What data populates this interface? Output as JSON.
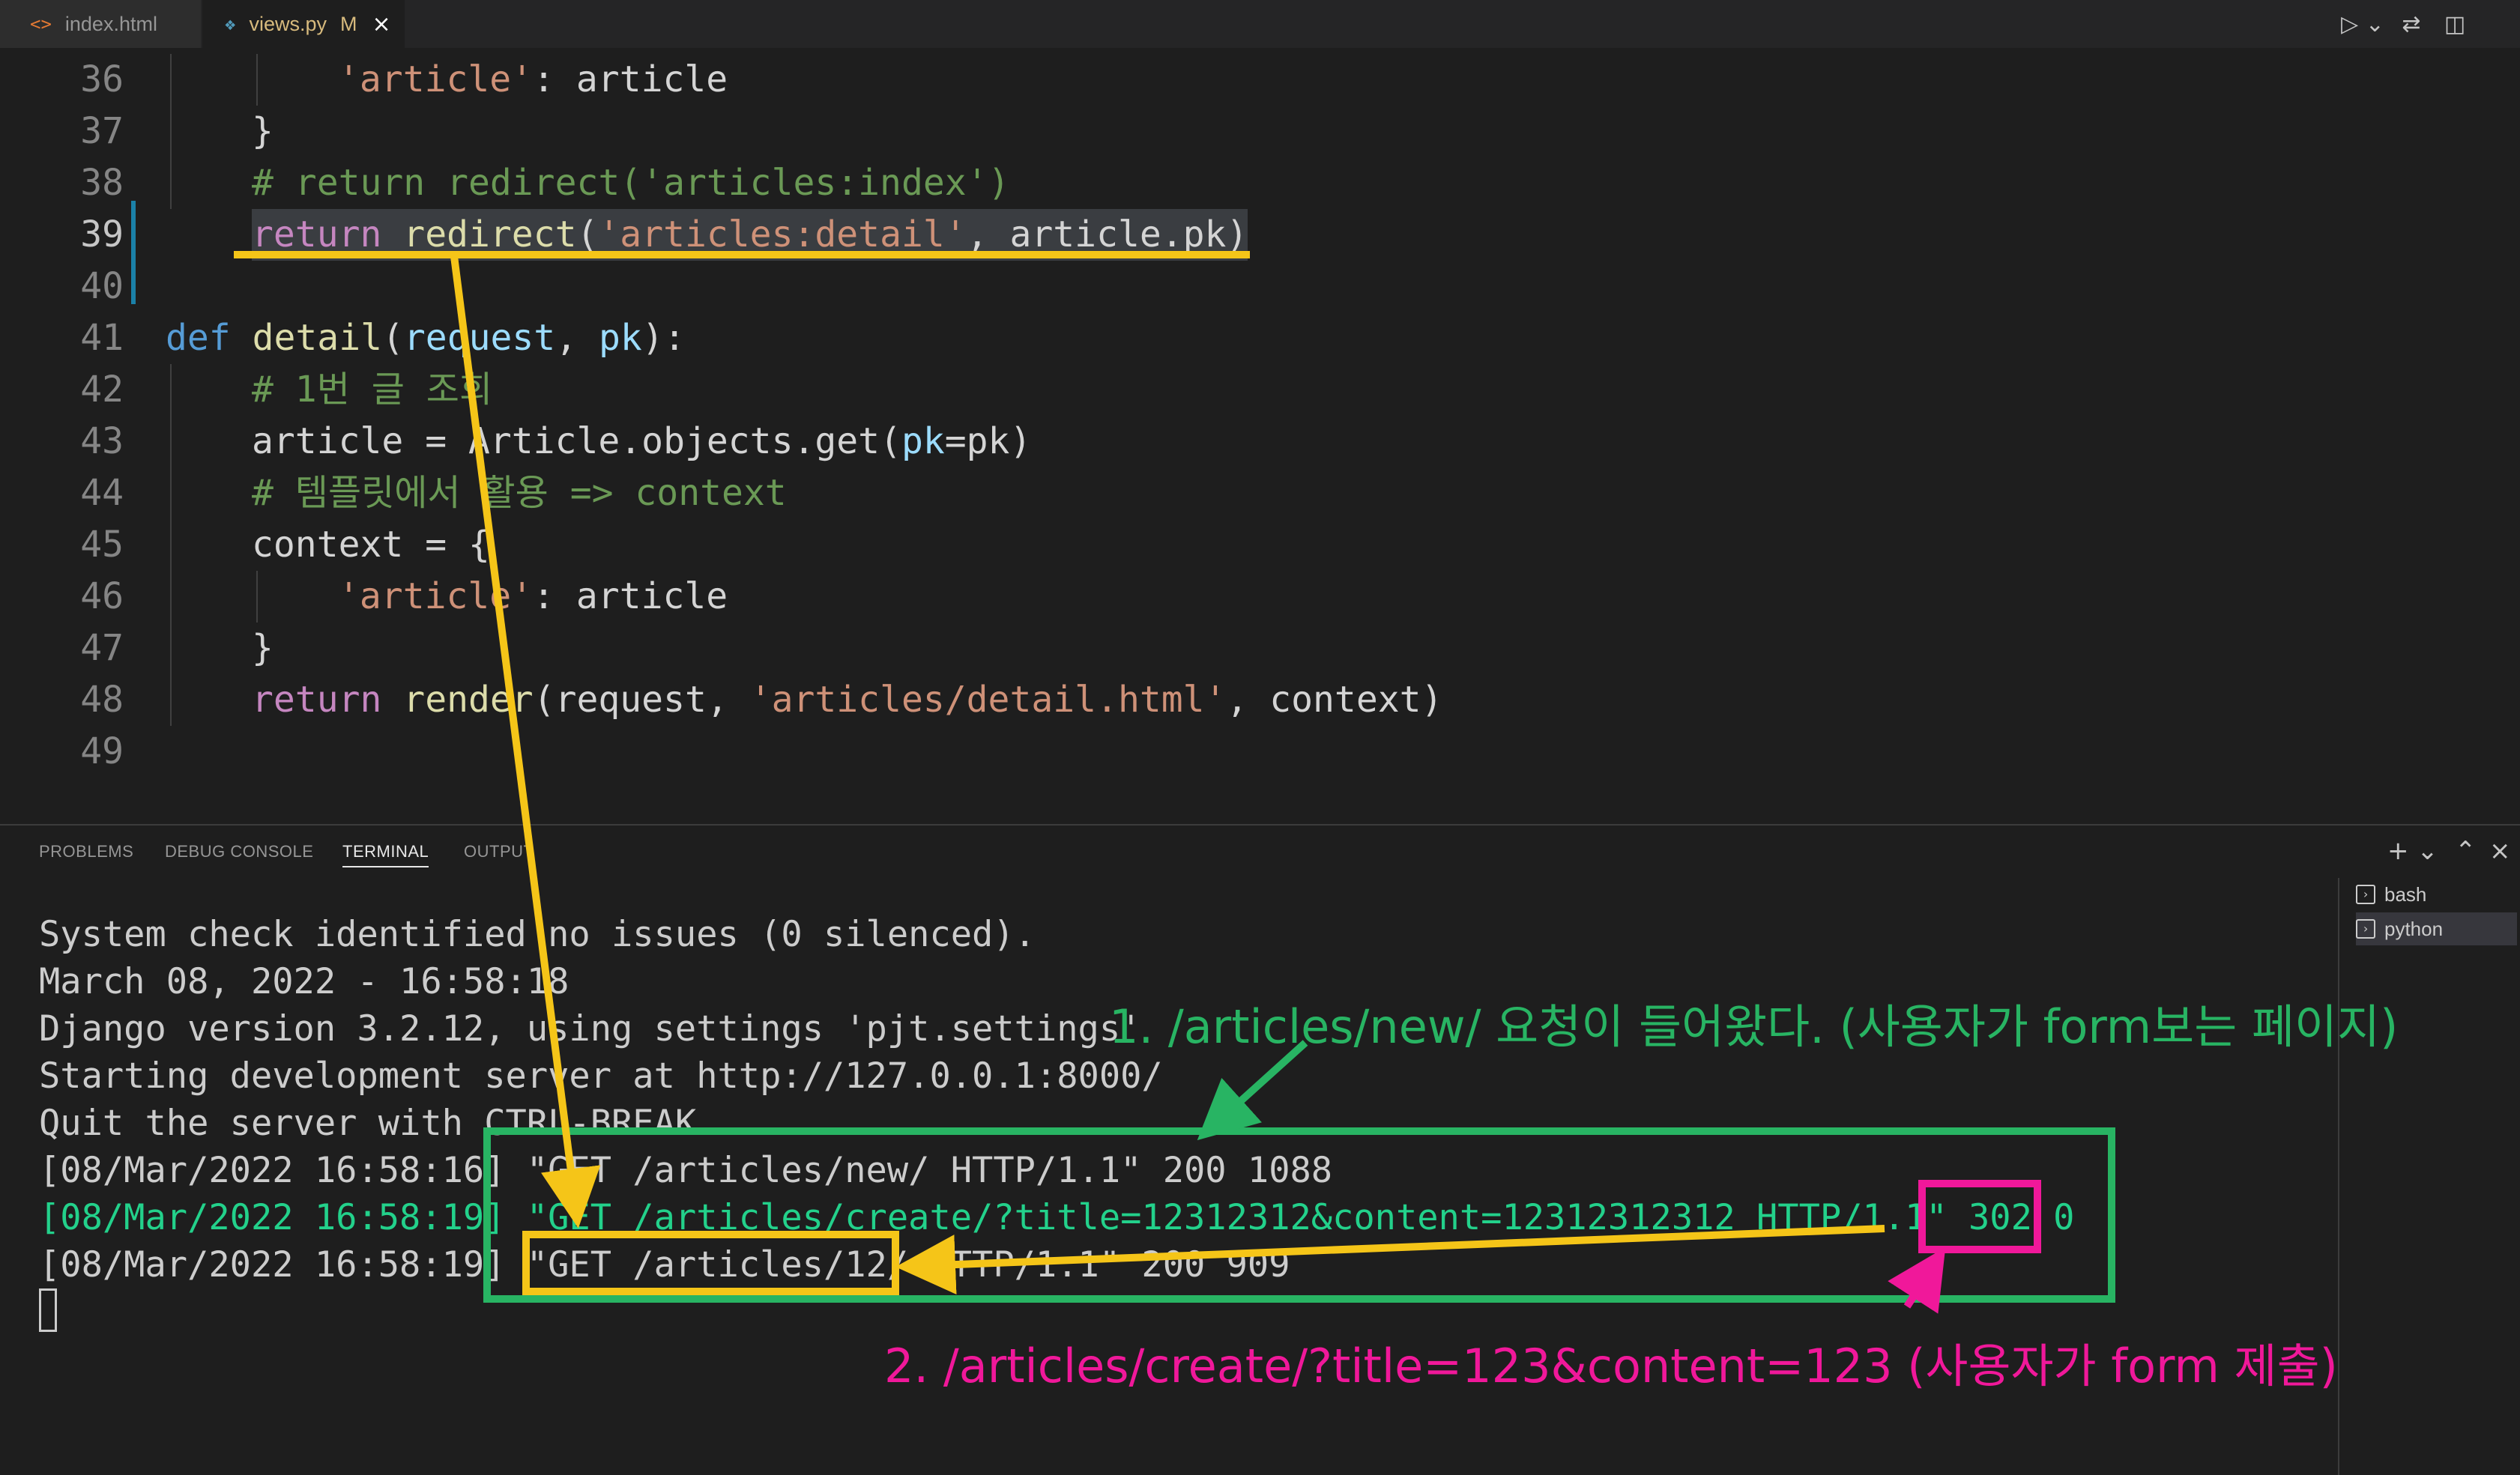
{
  "tabs": [
    {
      "icon": "<>",
      "label": "index.html"
    },
    {
      "icon": "py",
      "label": "views.py",
      "modified": "M",
      "close": "×"
    }
  ],
  "toolbar": {
    "run": "▷ ⌄",
    "compare": "⇄",
    "split": "◫"
  },
  "editor": {
    "lines": [
      {
        "n": "36",
        "indent": 2,
        "tokens": [
          [
            "str",
            "'article'"
          ],
          [
            "txt",
            ": article"
          ]
        ]
      },
      {
        "n": "37",
        "indent": 1,
        "tokens": [
          [
            "txt",
            "}"
          ]
        ]
      },
      {
        "n": "38",
        "indent": 1,
        "tokens": [
          [
            "cmt",
            "# return redirect('articles:index')"
          ]
        ]
      },
      {
        "n": "39",
        "indent": 1,
        "active": true,
        "tokens": [
          [
            "kw",
            "return"
          ],
          [
            "txt",
            " "
          ],
          [
            "fn",
            "redirect"
          ],
          [
            "txt",
            "("
          ],
          [
            "str",
            "'articles:detail'"
          ],
          [
            "txt",
            ", article.pk)"
          ]
        ]
      },
      {
        "n": "40",
        "indent": 0,
        "tokens": []
      },
      {
        "n": "41",
        "indent": 0,
        "tokens": [
          [
            "kw-def",
            "def"
          ],
          [
            "txt",
            " "
          ],
          [
            "fn",
            "detail"
          ],
          [
            "txt",
            "("
          ],
          [
            "var",
            "request"
          ],
          [
            "txt",
            ", "
          ],
          [
            "var",
            "pk"
          ],
          [
            "txt",
            "):"
          ]
        ]
      },
      {
        "n": "42",
        "indent": 1,
        "tokens": [
          [
            "cmt",
            "# 1번 글 조회"
          ]
        ]
      },
      {
        "n": "43",
        "indent": 1,
        "tokens": [
          [
            "txt",
            "article = Article.objects.get("
          ],
          [
            "var",
            "pk"
          ],
          [
            "txt",
            "=pk)"
          ]
        ]
      },
      {
        "n": "44",
        "indent": 1,
        "tokens": [
          [
            "cmt",
            "# 템플릿에서 활용 => context"
          ]
        ]
      },
      {
        "n": "45",
        "indent": 1,
        "tokens": [
          [
            "txt",
            "context = {"
          ]
        ]
      },
      {
        "n": "46",
        "indent": 2,
        "tokens": [
          [
            "str",
            "'article'"
          ],
          [
            "txt",
            ": article"
          ]
        ]
      },
      {
        "n": "47",
        "indent": 1,
        "tokens": [
          [
            "txt",
            "}"
          ]
        ]
      },
      {
        "n": "48",
        "indent": 1,
        "tokens": [
          [
            "kw",
            "return"
          ],
          [
            "txt",
            " "
          ],
          [
            "fn",
            "render"
          ],
          [
            "txt",
            "(request, "
          ],
          [
            "str",
            "'articles/detail.html'"
          ],
          [
            "txt",
            ", context)"
          ]
        ]
      },
      {
        "n": "49",
        "indent": 0,
        "tokens": []
      }
    ]
  },
  "panel": {
    "tabs": [
      "PROBLEMS",
      "DEBUG CONSOLE",
      "TERMINAL",
      "OUTPUT"
    ],
    "active_tab": "TERMINAL",
    "actions": {
      "add": "+ ⌄",
      "maximize": "⌃",
      "close": "×"
    },
    "terminals": [
      "bash",
      "python"
    ]
  },
  "terminal": {
    "lines": [
      "System check identified no issues (0 silenced).",
      "March 08, 2022 - 16:58:18",
      "Django version 3.2.12, using settings 'pjt.settings'",
      "Starting development server at http://127.0.0.1:8000/",
      "Quit the server with CTRL-BREAK.",
      "[08/Mar/2022 16:58:16] \"GET /articles/new/ HTTP/1.1\" 200 1088",
      "[08/Mar/2022 16:58:19] \"GET /articles/create/?title=12312312&content=12312312312 HTTP/1.1\" 302 0",
      "[08/Mar/2022 16:58:19] \"GET /articles/12/ HTTP/1.1\" 200 909"
    ]
  },
  "annotations": {
    "step1": "1. /articles/new/ 요청이 들어왔다. (사용자가 form보는 페이지)",
    "step2": "2. /articles/create/?title=123&content=123 (사용자가 form 제출)"
  },
  "colors": {
    "annotation_yellow": "#f5c518",
    "annotation_green": "#28b463",
    "annotation_pink": "#f0189a",
    "terminal_request_green": "#23d18b"
  }
}
